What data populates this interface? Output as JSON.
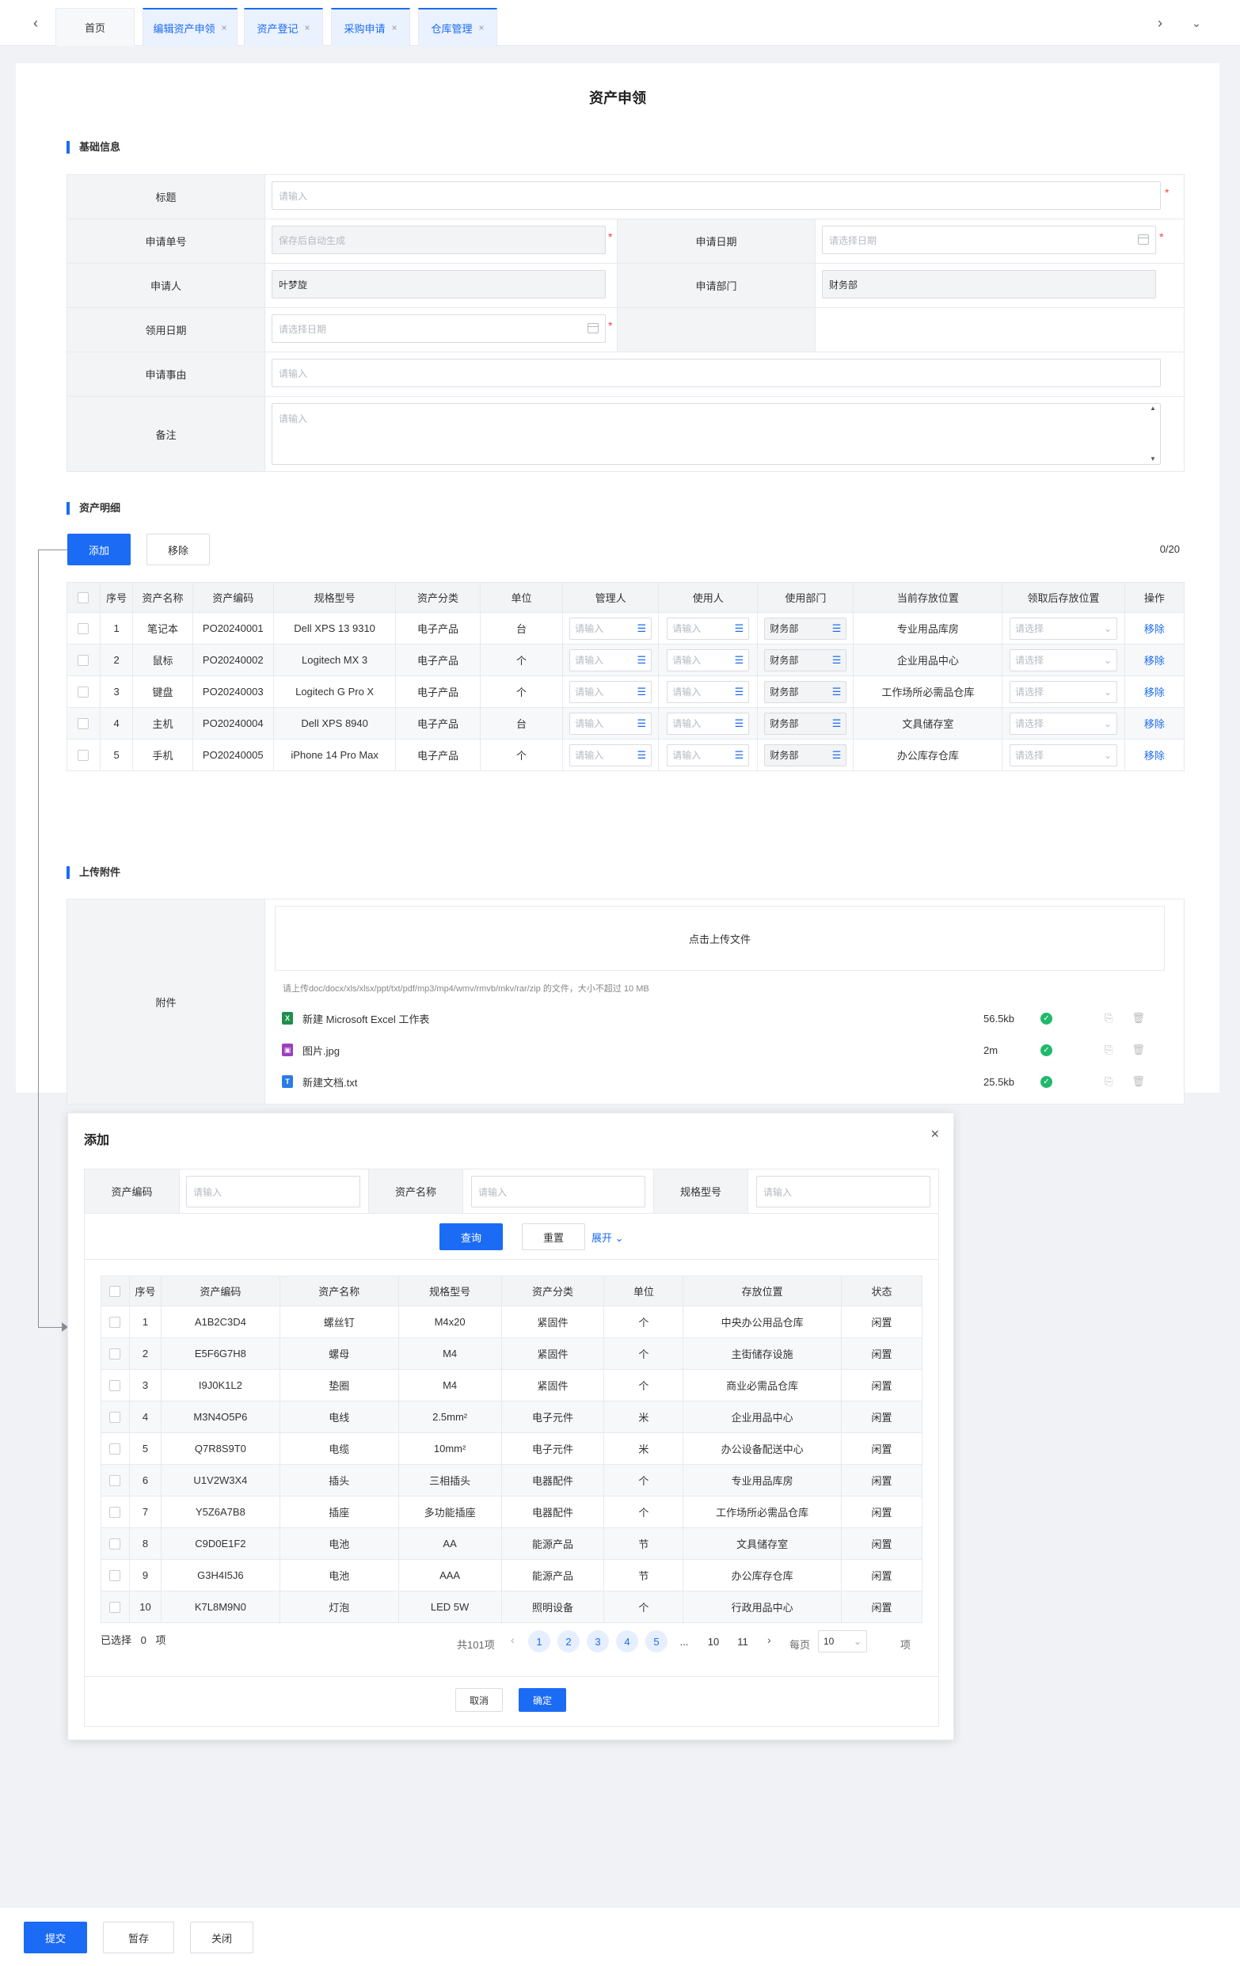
{
  "tabs": [
    {
      "label": "首页"
    },
    {
      "label": "编辑资产申领"
    },
    {
      "label": "资产登记"
    },
    {
      "label": "采购申请"
    },
    {
      "label": "仓库管理"
    }
  ],
  "page_title": "资产申领",
  "basic": {
    "section_title": "基础信息",
    "title_label": "标题",
    "title_placeholder": "请输入",
    "order_label": "申请单号",
    "order_placeholder": "保存后自动生成",
    "date_label": "申请日期",
    "date_placeholder": "请选择日期",
    "applicant_label": "申请人",
    "applicant_value": "叶梦旋",
    "dept_label": "申请部门",
    "dept_value": "财务部",
    "use_date_label": "领用日期",
    "use_date_placeholder": "请选择日期",
    "reason_label": "申请事由",
    "reason_placeholder": "请输入",
    "remark_label": "备注",
    "remark_placeholder": "请输入"
  },
  "detail": {
    "section_title": "资产明细",
    "add_btn": "添加",
    "remove_btn": "移除",
    "count": "0/20",
    "headers": [
      "序号",
      "资产名称",
      "资产编码",
      "规格型号",
      "资产分类",
      "单位",
      "管理人",
      "使用人",
      "使用部门",
      "当前存放位置",
      "领取后存放位置",
      "操作"
    ],
    "input_placeholder": "请输入",
    "select_placeholder": "请选择",
    "action_label": "移除",
    "rows": [
      {
        "no": "1",
        "name": "笔记本",
        "code": "PO20240001",
        "model": "Dell XPS 13 9310",
        "category": "电子产品",
        "unit": "台",
        "dept": "财务部",
        "location": "专业用品库房"
      },
      {
        "no": "2",
        "name": "鼠标",
        "code": "PO20240002",
        "model": "Logitech MX 3",
        "category": "电子产品",
        "unit": "个",
        "dept": "财务部",
        "location": "企业用品中心"
      },
      {
        "no": "3",
        "name": "键盘",
        "code": "PO20240003",
        "model": "Logitech G Pro X",
        "category": "电子产品",
        "unit": "个",
        "dept": "财务部",
        "location": "工作场所必需品仓库"
      },
      {
        "no": "4",
        "name": "主机",
        "code": "PO20240004",
        "model": "Dell XPS 8940",
        "category": "电子产品",
        "unit": "台",
        "dept": "财务部",
        "location": "文具储存室"
      },
      {
        "no": "5",
        "name": "手机",
        "code": "PO20240005",
        "model": "iPhone 14 Pro Max",
        "category": "电子产品",
        "unit": "个",
        "dept": "财务部",
        "location": "办公库存仓库"
      }
    ]
  },
  "attach": {
    "section_title": "上传附件",
    "label": "附件",
    "upload_text": "点击上传文件",
    "hint": "请上传doc/docx/xls/xlsx/ppt/txt/pdf/mp3/mp4/wmv/rmvb/mkv/rar/zip 的文件，大小不超过 10 MB",
    "files": [
      {
        "name": "新建 Microsoft Excel 工作表",
        "size": "56.5kb",
        "icon": "excel-icon",
        "color": "#1f8f4e"
      },
      {
        "name": "图片.jpg",
        "size": "2m",
        "icon": "image-icon",
        "color": "#9b3fbf"
      },
      {
        "name": "新建文档.txt",
        "size": "25.5kb",
        "icon": "text-file-icon",
        "color": "#2c7be5"
      }
    ]
  },
  "dialog": {
    "title": "添加",
    "code_label": "资产编码",
    "name_label": "资产名称",
    "model_label": "规格型号",
    "placeholder": "请输入",
    "query_btn": "查询",
    "reset_btn": "重置",
    "expand_btn": "展开",
    "headers": [
      "序号",
      "资产编码",
      "资产名称",
      "规格型号",
      "资产分类",
      "单位",
      "存放位置",
      "状态"
    ],
    "rows": [
      {
        "no": "1",
        "code": "A1B2C3D4",
        "name": "螺丝钉",
        "model": "M4x20",
        "category": "紧固件",
        "unit": "个",
        "location": "中央办公用品仓库",
        "status": "闲置"
      },
      {
        "no": "2",
        "code": "E5F6G7H8",
        "name": "螺母",
        "model": "M4",
        "category": "紧固件",
        "unit": "个",
        "location": "主街储存设施",
        "status": "闲置"
      },
      {
        "no": "3",
        "code": "I9J0K1L2",
        "name": "垫圈",
        "model": "M4",
        "category": "紧固件",
        "unit": "个",
        "location": "商业必需品仓库",
        "status": "闲置"
      },
      {
        "no": "4",
        "code": "M3N4O5P6",
        "name": "电线",
        "model": "2.5mm²",
        "category": "电子元件",
        "unit": "米",
        "location": "企业用品中心",
        "status": "闲置"
      },
      {
        "no": "5",
        "code": "Q7R8S9T0",
        "name": "电缆",
        "model": "10mm²",
        "category": "电子元件",
        "unit": "米",
        "location": "办公设备配送中心",
        "status": "闲置"
      },
      {
        "no": "6",
        "code": "U1V2W3X4",
        "name": "插头",
        "model": "三相插头",
        "category": "电器配件",
        "unit": "个",
        "location": "专业用品库房",
        "status": "闲置"
      },
      {
        "no": "7",
        "code": "Y5Z6A7B8",
        "name": "插座",
        "model": "多功能插座",
        "category": "电器配件",
        "unit": "个",
        "location": "工作场所必需品仓库",
        "status": "闲置"
      },
      {
        "no": "8",
        "code": "C9D0E1F2",
        "name": "电池",
        "model": "AA",
        "category": "能源产品",
        "unit": "节",
        "location": "文具储存室",
        "status": "闲置"
      },
      {
        "no": "9",
        "code": "G3H4I5J6",
        "name": "电池",
        "model": "AAA",
        "category": "能源产品",
        "unit": "节",
        "location": "办公库存仓库",
        "status": "闲置"
      },
      {
        "no": "10",
        "code": "K7L8M9N0",
        "name": "灯泡",
        "model": "LED 5W",
        "category": "照明设备",
        "unit": "个",
        "location": "行政用品中心",
        "status": "闲置"
      }
    ],
    "selected_prefix": "已选择",
    "selected_count": "0",
    "selected_suffix": "项",
    "total": "共101项",
    "pages": [
      "1",
      "2",
      "3",
      "4",
      "5",
      "...",
      "10",
      "11"
    ],
    "per_page_label": "每页",
    "per_page_value": "10",
    "per_page_suffix": "项",
    "cancel_btn": "取消",
    "ok_btn": "确定"
  },
  "footer": {
    "submit_btn": "提交",
    "draft_btn": "暂存",
    "close_btn": "关闭"
  }
}
